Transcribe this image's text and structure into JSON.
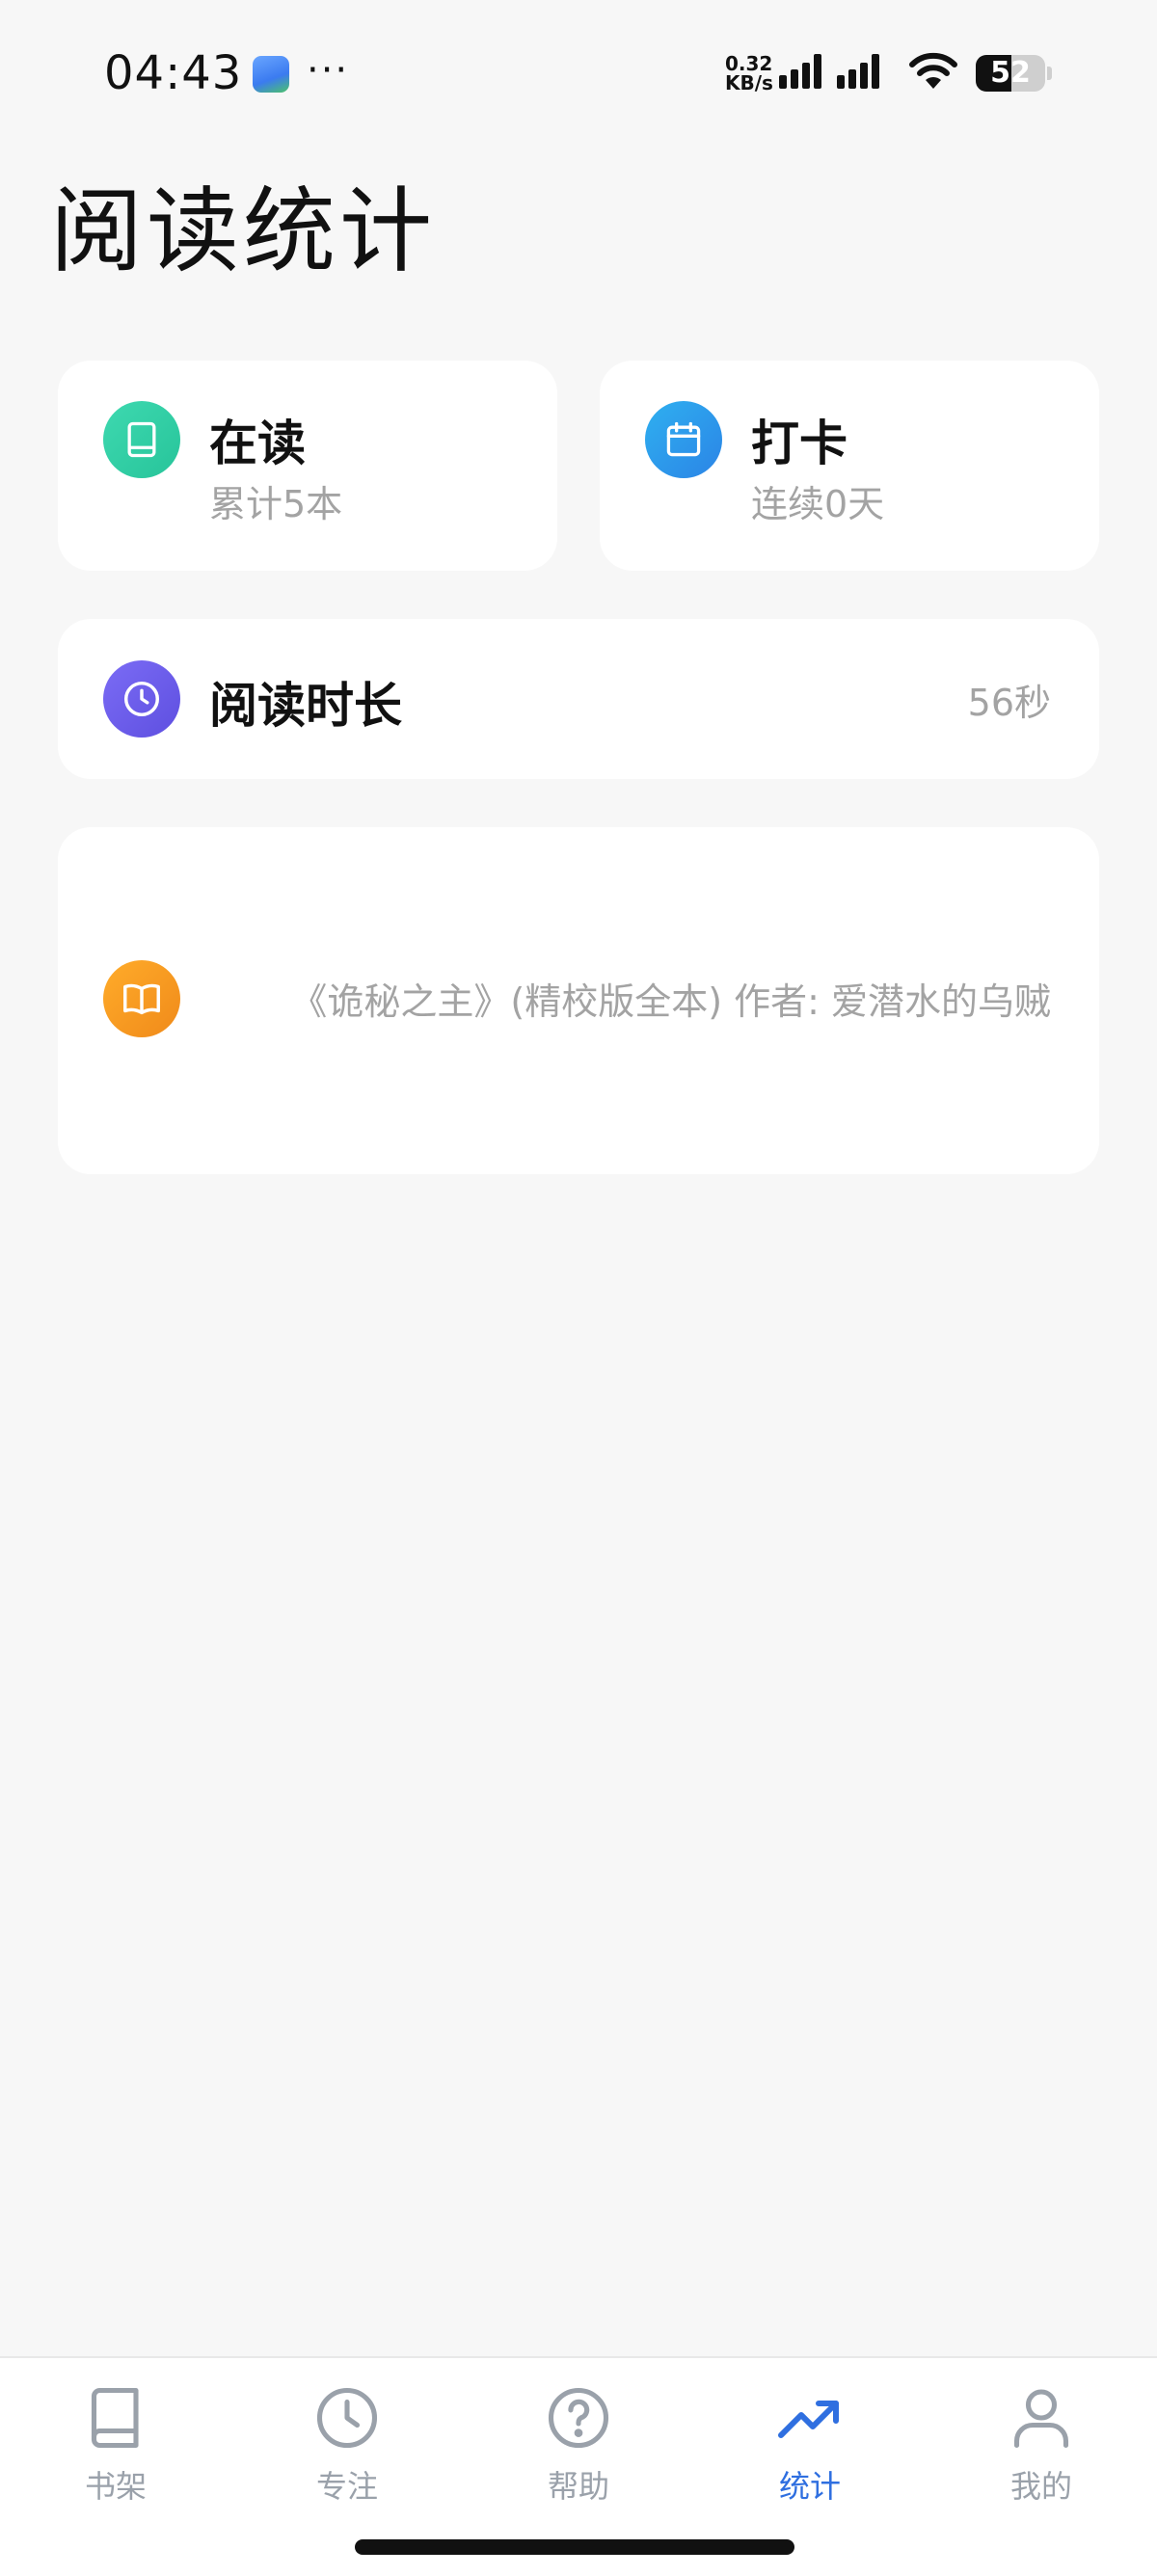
{
  "status_bar": {
    "time": "04:43",
    "more": "···",
    "speed_value": "0.32",
    "speed_unit": "KB/s",
    "battery": "52"
  },
  "page": {
    "title": "阅读统计"
  },
  "cards": {
    "reading": {
      "title": "在读",
      "subtitle": "累计5本",
      "icon": "book-icon"
    },
    "checkin": {
      "title": "打卡",
      "subtitle": "连续0天",
      "icon": "calendar-icon"
    },
    "duration": {
      "title": "阅读时长",
      "value": "56秒",
      "icon": "clock-icon"
    },
    "recent": {
      "book": "《诡秘之主》(精校版全本) 作者: 爱潜水的乌贼",
      "icon": "open-book-icon"
    }
  },
  "bottom_nav": {
    "items": [
      {
        "label": "书架",
        "icon": "bookshelf-icon",
        "active": false
      },
      {
        "label": "专注",
        "icon": "clock-icon",
        "active": false
      },
      {
        "label": "帮助",
        "icon": "help-icon",
        "active": false
      },
      {
        "label": "统计",
        "icon": "trend-icon",
        "active": true
      },
      {
        "label": "我的",
        "icon": "user-icon",
        "active": false
      }
    ]
  },
  "colors": {
    "background": "#f7f7f7",
    "accent": "#2f6fe0",
    "reading_icon": "#2fcf9f",
    "checkin_icon": "#2b96ea",
    "duration_icon": "#6c5de9",
    "recent_icon": "#f59a20"
  }
}
